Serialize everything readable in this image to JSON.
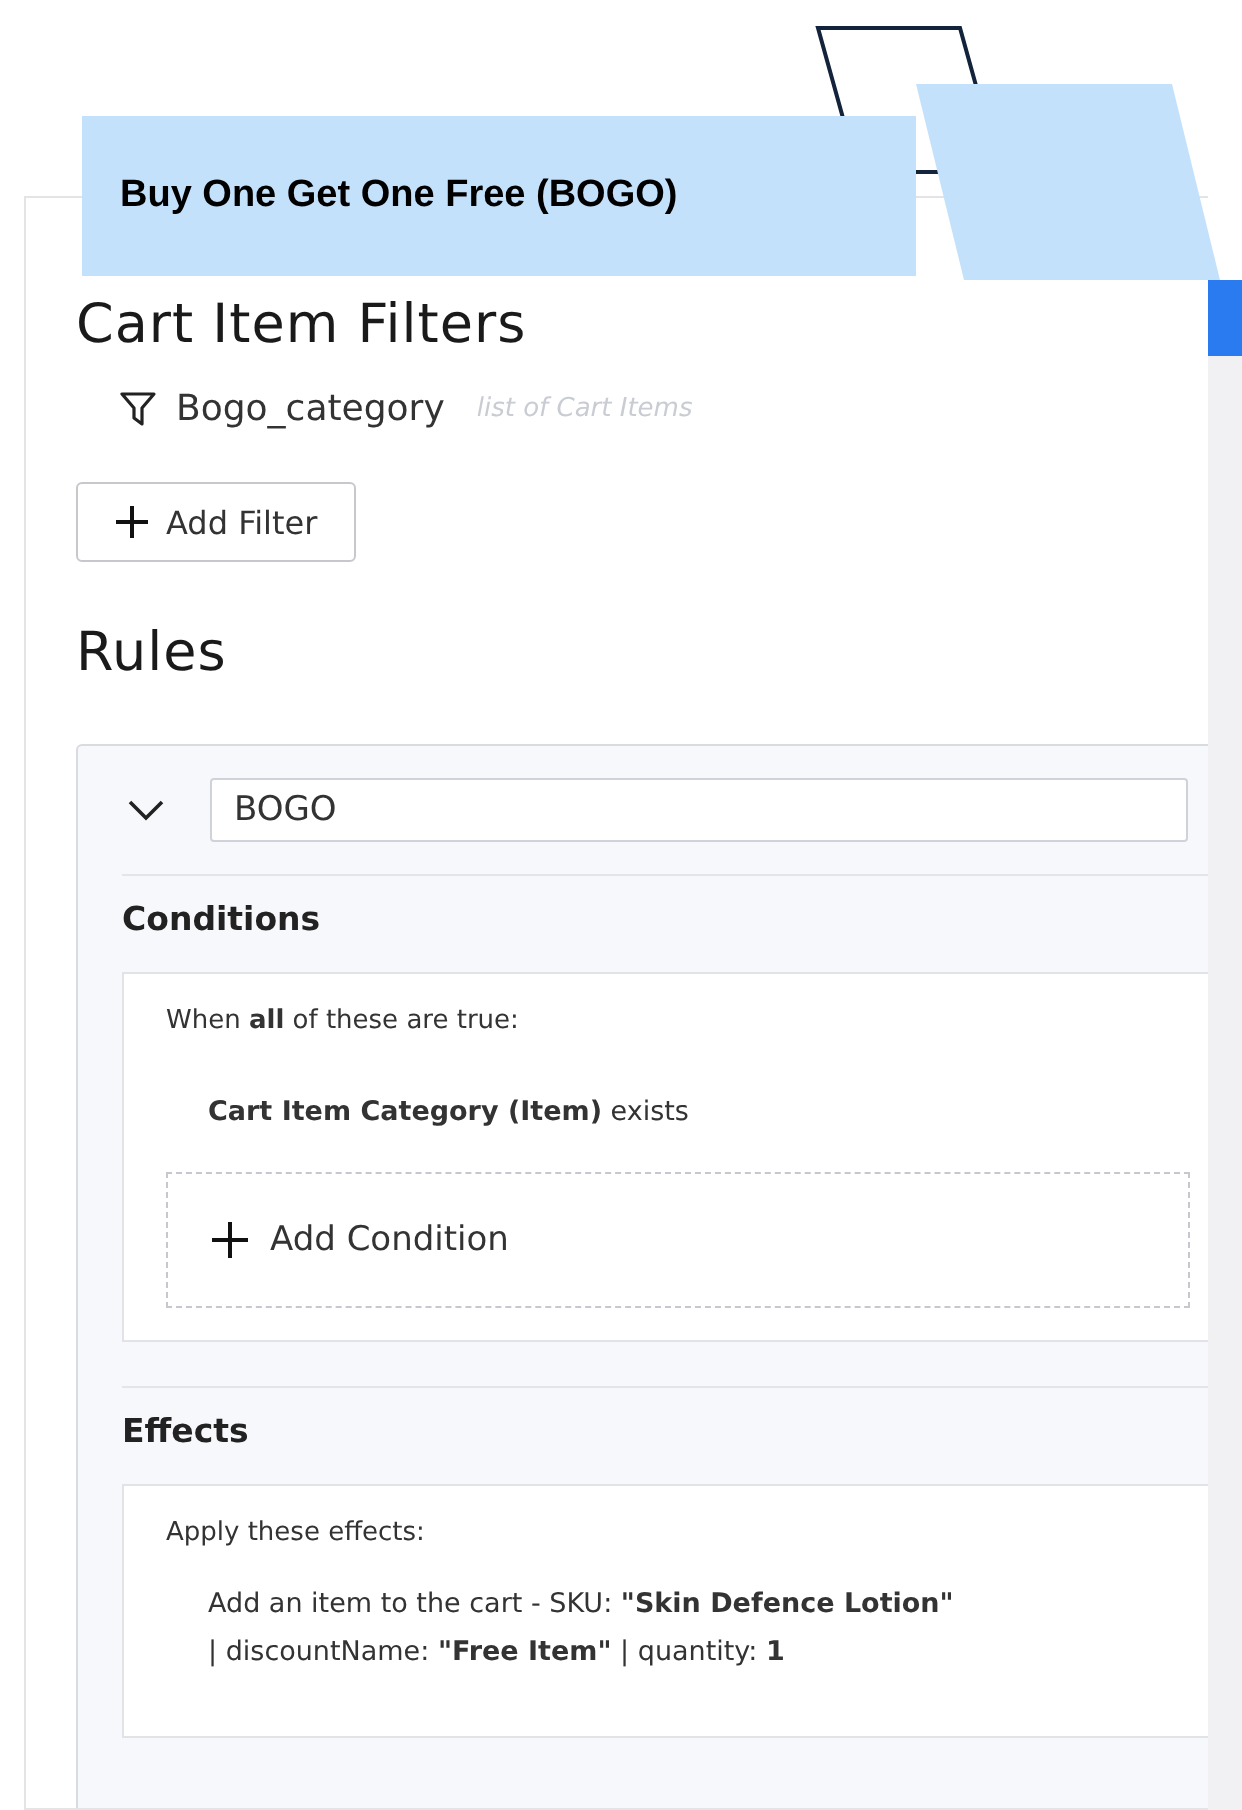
{
  "banner": {
    "title": "Buy One Get One Free (BOGO)"
  },
  "cart_item_filters": {
    "title": "Cart Item Filters",
    "filters": [
      {
        "name": "Bogo_category",
        "type": "list of Cart Items"
      }
    ],
    "add_button": "Add Filter"
  },
  "rules": {
    "title": "Rules",
    "items": [
      {
        "expanded": true,
        "name": "BOGO",
        "conditions": {
          "title": "Conditions",
          "intro": "When **all** of these are true:",
          "items": [
            "**Cart Item Category (Item)** exists"
          ],
          "add_button": "Add Condition"
        },
        "effects": {
          "title": "Effects",
          "intro": "Apply these effects:",
          "items": [
            "Add an item to the cart - SKU: **\"Skin Defence Lotion\"** | discountName: **\"Free Item\"** | quantity: **1**"
          ]
        }
      }
    ]
  }
}
